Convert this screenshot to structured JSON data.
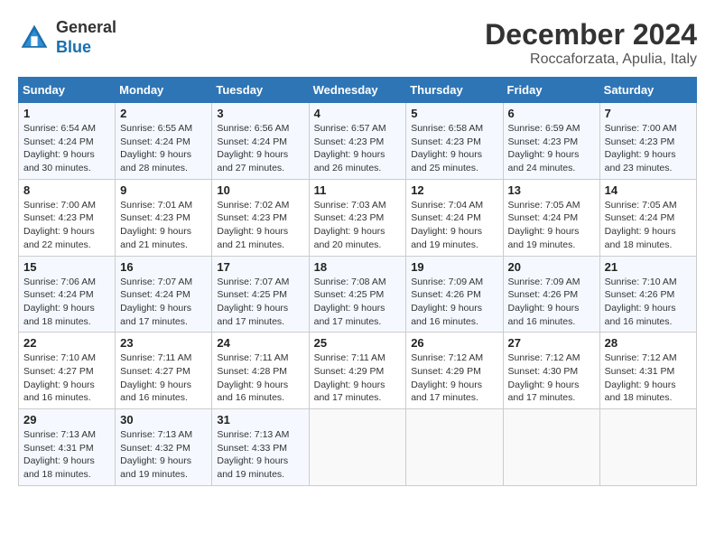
{
  "logo": {
    "general": "General",
    "blue": "Blue"
  },
  "title": "December 2024",
  "subtitle": "Roccaforzata, Apulia, Italy",
  "weekdays": [
    "Sunday",
    "Monday",
    "Tuesday",
    "Wednesday",
    "Thursday",
    "Friday",
    "Saturday"
  ],
  "weeks": [
    [
      {
        "day": 1,
        "sunrise": "6:54 AM",
        "sunset": "4:24 PM",
        "daylight": "9 hours and 30 minutes."
      },
      {
        "day": 2,
        "sunrise": "6:55 AM",
        "sunset": "4:24 PM",
        "daylight": "9 hours and 28 minutes."
      },
      {
        "day": 3,
        "sunrise": "6:56 AM",
        "sunset": "4:24 PM",
        "daylight": "9 hours and 27 minutes."
      },
      {
        "day": 4,
        "sunrise": "6:57 AM",
        "sunset": "4:23 PM",
        "daylight": "9 hours and 26 minutes."
      },
      {
        "day": 5,
        "sunrise": "6:58 AM",
        "sunset": "4:23 PM",
        "daylight": "9 hours and 25 minutes."
      },
      {
        "day": 6,
        "sunrise": "6:59 AM",
        "sunset": "4:23 PM",
        "daylight": "9 hours and 24 minutes."
      },
      {
        "day": 7,
        "sunrise": "7:00 AM",
        "sunset": "4:23 PM",
        "daylight": "9 hours and 23 minutes."
      }
    ],
    [
      {
        "day": 8,
        "sunrise": "7:00 AM",
        "sunset": "4:23 PM",
        "daylight": "9 hours and 22 minutes."
      },
      {
        "day": 9,
        "sunrise": "7:01 AM",
        "sunset": "4:23 PM",
        "daylight": "9 hours and 21 minutes."
      },
      {
        "day": 10,
        "sunrise": "7:02 AM",
        "sunset": "4:23 PM",
        "daylight": "9 hours and 21 minutes."
      },
      {
        "day": 11,
        "sunrise": "7:03 AM",
        "sunset": "4:23 PM",
        "daylight": "9 hours and 20 minutes."
      },
      {
        "day": 12,
        "sunrise": "7:04 AM",
        "sunset": "4:24 PM",
        "daylight": "9 hours and 19 minutes."
      },
      {
        "day": 13,
        "sunrise": "7:05 AM",
        "sunset": "4:24 PM",
        "daylight": "9 hours and 19 minutes."
      },
      {
        "day": 14,
        "sunrise": "7:05 AM",
        "sunset": "4:24 PM",
        "daylight": "9 hours and 18 minutes."
      }
    ],
    [
      {
        "day": 15,
        "sunrise": "7:06 AM",
        "sunset": "4:24 PM",
        "daylight": "9 hours and 18 minutes."
      },
      {
        "day": 16,
        "sunrise": "7:07 AM",
        "sunset": "4:24 PM",
        "daylight": "9 hours and 17 minutes."
      },
      {
        "day": 17,
        "sunrise": "7:07 AM",
        "sunset": "4:25 PM",
        "daylight": "9 hours and 17 minutes."
      },
      {
        "day": 18,
        "sunrise": "7:08 AM",
        "sunset": "4:25 PM",
        "daylight": "9 hours and 17 minutes."
      },
      {
        "day": 19,
        "sunrise": "7:09 AM",
        "sunset": "4:26 PM",
        "daylight": "9 hours and 16 minutes."
      },
      {
        "day": 20,
        "sunrise": "7:09 AM",
        "sunset": "4:26 PM",
        "daylight": "9 hours and 16 minutes."
      },
      {
        "day": 21,
        "sunrise": "7:10 AM",
        "sunset": "4:26 PM",
        "daylight": "9 hours and 16 minutes."
      }
    ],
    [
      {
        "day": 22,
        "sunrise": "7:10 AM",
        "sunset": "4:27 PM",
        "daylight": "9 hours and 16 minutes."
      },
      {
        "day": 23,
        "sunrise": "7:11 AM",
        "sunset": "4:27 PM",
        "daylight": "9 hours and 16 minutes."
      },
      {
        "day": 24,
        "sunrise": "7:11 AM",
        "sunset": "4:28 PM",
        "daylight": "9 hours and 16 minutes."
      },
      {
        "day": 25,
        "sunrise": "7:11 AM",
        "sunset": "4:29 PM",
        "daylight": "9 hours and 17 minutes."
      },
      {
        "day": 26,
        "sunrise": "7:12 AM",
        "sunset": "4:29 PM",
        "daylight": "9 hours and 17 minutes."
      },
      {
        "day": 27,
        "sunrise": "7:12 AM",
        "sunset": "4:30 PM",
        "daylight": "9 hours and 17 minutes."
      },
      {
        "day": 28,
        "sunrise": "7:12 AM",
        "sunset": "4:31 PM",
        "daylight": "9 hours and 18 minutes."
      }
    ],
    [
      {
        "day": 29,
        "sunrise": "7:13 AM",
        "sunset": "4:31 PM",
        "daylight": "9 hours and 18 minutes."
      },
      {
        "day": 30,
        "sunrise": "7:13 AM",
        "sunset": "4:32 PM",
        "daylight": "9 hours and 19 minutes."
      },
      {
        "day": 31,
        "sunrise": "7:13 AM",
        "sunset": "4:33 PM",
        "daylight": "9 hours and 19 minutes."
      },
      null,
      null,
      null,
      null
    ]
  ]
}
